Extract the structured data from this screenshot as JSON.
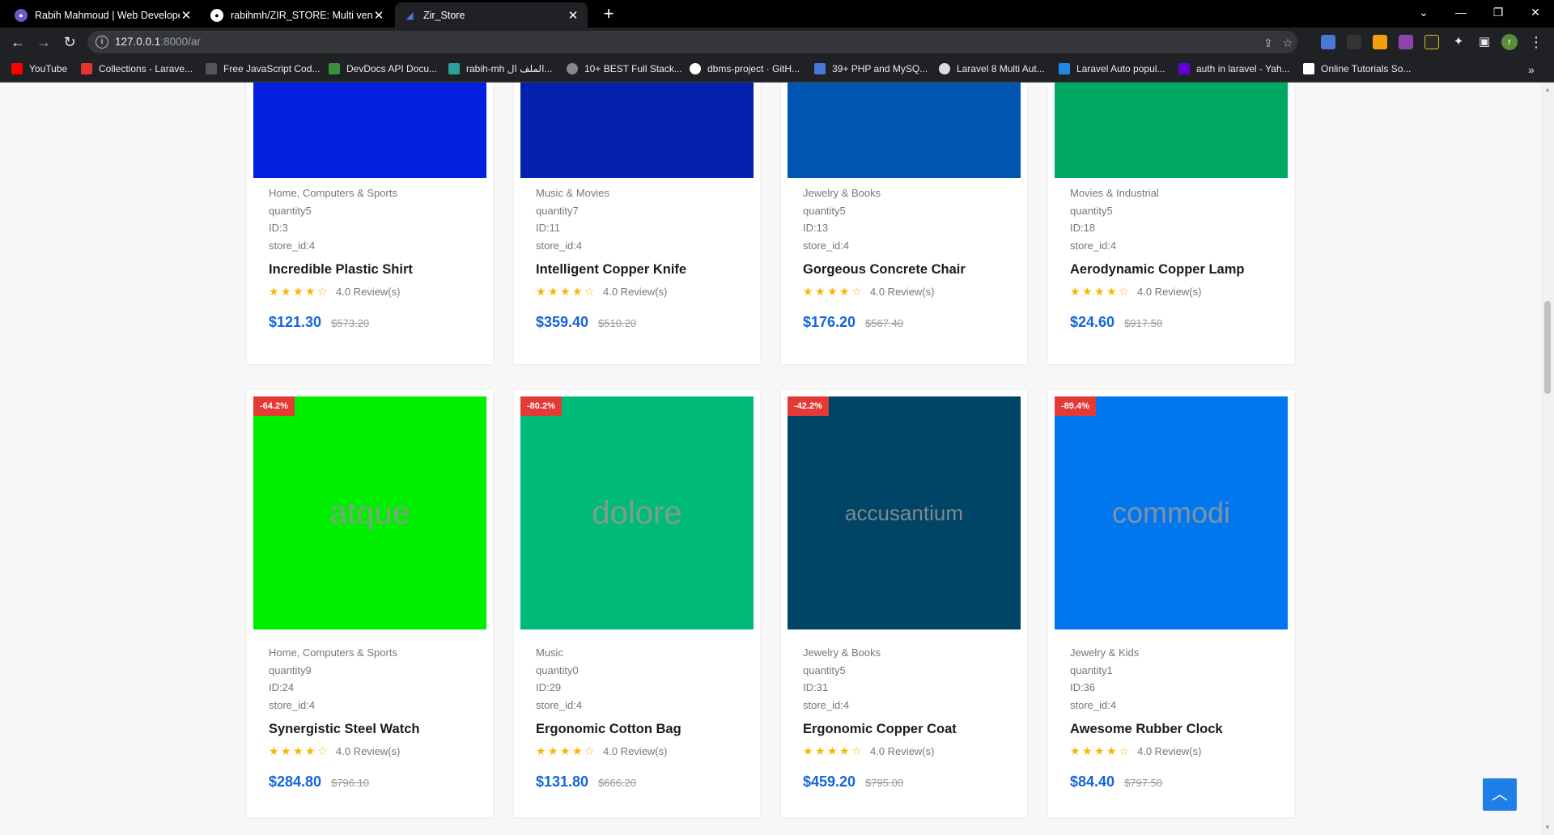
{
  "browser": {
    "tabs": [
      {
        "title": "Rabih Mahmoud | Web Develope",
        "active": false,
        "favicon": "portfolio-icon"
      },
      {
        "title": "rabihmh/ZIR_STORE: Multi vendo",
        "active": false,
        "favicon": "github-icon"
      },
      {
        "title": "Zir_Store",
        "active": true,
        "favicon": "site-icon"
      }
    ],
    "url_host": "127.0.0.1",
    "url_rest": ":8000/ar",
    "profile_initial": "r",
    "bookmarks": [
      {
        "label": "YouTube",
        "color": "#ff0000"
      },
      {
        "label": "Collections - Larave...",
        "color": "#e3342f"
      },
      {
        "label": "Free JavaScript Cod...",
        "color": "#555555"
      },
      {
        "label": "DevDocs API Docu...",
        "color": "#3a8f3a"
      },
      {
        "label": "rabih-mh الملف ال...",
        "color": "#2aa198"
      },
      {
        "label": "10+ BEST Full Stack...",
        "color": "#888888"
      },
      {
        "label": "dbms-project · GitH...",
        "color": "#ffffff"
      },
      {
        "label": "39+ PHP and MySQ...",
        "color": "#4a78d6"
      },
      {
        "label": "Laravel 8 Multi Aut...",
        "color": "#dddddd"
      },
      {
        "label": "Laravel Auto popul...",
        "color": "#1e88e5"
      },
      {
        "label": "auth in laravel - Yah...",
        "color": "#6001d2"
      },
      {
        "label": "Online Tutorials So...",
        "color": "#ffffff"
      }
    ]
  },
  "products_row1": [
    {
      "color": "#0220dd",
      "category": "Home, Computers & Sports",
      "quantity": "quantity5",
      "id": "ID:3",
      "store": "store_id:4",
      "name": "Incredible Plastic Shirt",
      "reviews": "4.0 Review(s)",
      "price": "$121.30",
      "old_price": "$573.20",
      "rating": 4
    },
    {
      "color": "#0420ad",
      "category": "Music & Movies",
      "quantity": "quantity7",
      "id": "ID:11",
      "store": "store_id:4",
      "name": "Intelligent Copper Knife",
      "reviews": "4.0 Review(s)",
      "price": "$359.40",
      "old_price": "$510.20",
      "rating": 4
    },
    {
      "color": "#0055b0",
      "category": "Jewelry & Books",
      "quantity": "quantity5",
      "id": "ID:13",
      "store": "store_id:4",
      "name": "Gorgeous Concrete Chair",
      "reviews": "4.0 Review(s)",
      "price": "$176.20",
      "old_price": "$567.40",
      "rating": 4
    },
    {
      "color": "#00a866",
      "category": "Movies & Industrial",
      "quantity": "quantity5",
      "id": "ID:18",
      "store": "store_id:4",
      "name": "Aerodynamic Copper Lamp",
      "reviews": "4.0 Review(s)",
      "price": "$24.60",
      "old_price": "$917.50",
      "rating": 4
    }
  ],
  "products_row2": [
    {
      "color": "#00ee00",
      "placeholder": "atque",
      "discount": "-64.2%",
      "category": "Home, Computers & Sports",
      "quantity": "quantity9",
      "id": "ID:24",
      "store": "store_id:4",
      "name": "Synergistic Steel Watch",
      "reviews": "4.0 Review(s)",
      "price": "$284.80",
      "old_price": "$796.10",
      "rating": 4
    },
    {
      "color": "#00bb77",
      "placeholder": "dolore",
      "discount": "-80.2%",
      "category": "Music",
      "quantity": "quantity0",
      "id": "ID:29",
      "store": "store_id:4",
      "name": "Ergonomic Cotton Bag",
      "reviews": "4.0 Review(s)",
      "price": "$131.80",
      "old_price": "$666.20",
      "rating": 4
    },
    {
      "color": "#004466",
      "placeholder": "accusantium",
      "discount": "-42.2%",
      "category": "Jewelry & Books",
      "quantity": "quantity5",
      "id": "ID:31",
      "store": "store_id:4",
      "name": "Ergonomic Copper Coat",
      "reviews": "4.0 Review(s)",
      "price": "$459.20",
      "old_price": "$795.00",
      "rating": 4
    },
    {
      "color": "#0077ee",
      "placeholder": "commodi",
      "discount": "-89.4%",
      "category": "Jewelry & Kids",
      "quantity": "quantity1",
      "id": "ID:36",
      "store": "store_id:4",
      "name": "Awesome Rubber Clock",
      "reviews": "4.0 Review(s)",
      "price": "$84.40",
      "old_price": "$797.50",
      "rating": 4
    }
  ],
  "scroll_top_icon": "chevron-up-icon"
}
